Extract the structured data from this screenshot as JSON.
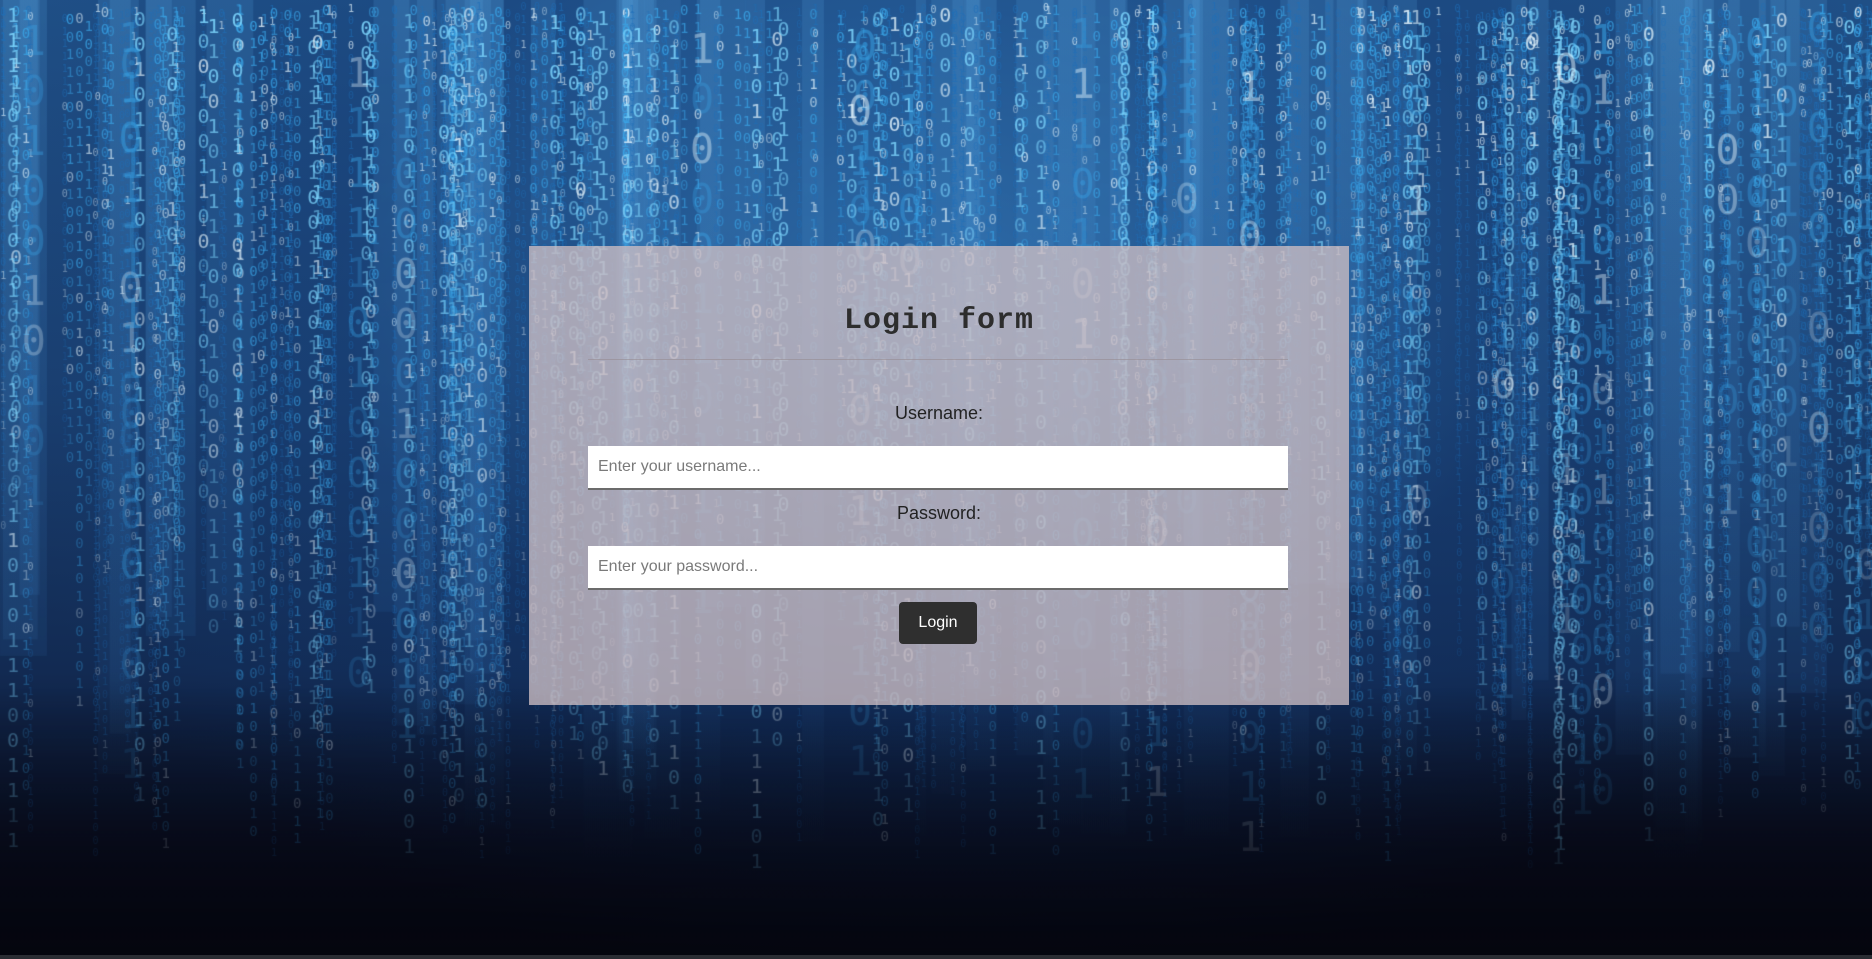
{
  "login_form": {
    "title": "Login form",
    "username_label": "Username:",
    "username_placeholder": "Enter your username...",
    "username_value": "",
    "password_label": "Password:",
    "password_placeholder": "Enter your password...",
    "password_value": "",
    "login_button_label": "Login"
  },
  "background": {
    "theme": "binary-digital-rain",
    "glyphs": [
      "0",
      "1"
    ],
    "colors": {
      "digit_bright": "#7fd8ff",
      "digit_mid": "#3aa6e8",
      "digit_dim": "#1f6fb8",
      "sky_top": "#1f4f86",
      "sky_bottom": "#05060f"
    }
  },
  "colors": {
    "panel": "#cdbec3",
    "button": "#2f2f2f",
    "title_text": "#2d2d2d"
  }
}
